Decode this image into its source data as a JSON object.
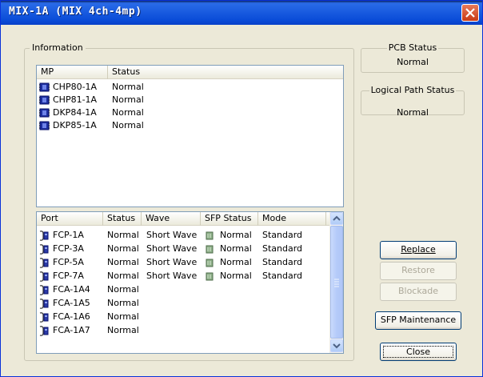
{
  "window": {
    "title": "MIX-1A (MIX 4ch-4mp)"
  },
  "information": {
    "legend": "Information"
  },
  "mp_list": {
    "columns": [
      "MP",
      "Status"
    ],
    "rows": [
      {
        "name": "CHP80-1A",
        "status": "Normal"
      },
      {
        "name": "CHP81-1A",
        "status": "Normal"
      },
      {
        "name": "DKP84-1A",
        "status": "Normal"
      },
      {
        "name": "DKP85-1A",
        "status": "Normal"
      }
    ]
  },
  "port_list": {
    "columns": [
      "Port",
      "Status",
      "Wave",
      "SFP Status",
      "Mode"
    ],
    "rows": [
      {
        "port": "FCP-1A",
        "status": "Normal",
        "wave": "Short Wave",
        "sfp": "Normal",
        "mode": "Standard"
      },
      {
        "port": "FCP-3A",
        "status": "Normal",
        "wave": "Short Wave",
        "sfp": "Normal",
        "mode": "Standard"
      },
      {
        "port": "FCP-5A",
        "status": "Normal",
        "wave": "Short Wave",
        "sfp": "Normal",
        "mode": "Standard"
      },
      {
        "port": "FCP-7A",
        "status": "Normal",
        "wave": "Short Wave",
        "sfp": "Normal",
        "mode": "Standard"
      },
      {
        "port": "FCA-1A4",
        "status": "Normal",
        "wave": "",
        "sfp": "",
        "mode": ""
      },
      {
        "port": "FCA-1A5",
        "status": "Normal",
        "wave": "",
        "sfp": "",
        "mode": ""
      },
      {
        "port": "FCA-1A6",
        "status": "Normal",
        "wave": "",
        "sfp": "",
        "mode": ""
      },
      {
        "port": "FCA-1A7",
        "status": "Normal",
        "wave": "",
        "sfp": "",
        "mode": ""
      }
    ]
  },
  "pcb_status": {
    "title": "PCB Status",
    "value": "Normal"
  },
  "logical_path_status": {
    "title": "Logical Path Status",
    "value": "Normal"
  },
  "buttons": {
    "replace": "Replace",
    "restore": "Restore",
    "blockade": "Blockade",
    "sfp_maintenance": "SFP Maintenance",
    "close": "Close"
  },
  "icons": {
    "mp_row": "processor-chip-icon",
    "port_row": "port-connector-icon",
    "sfp": "sfp-module-icon",
    "window_close": "close-icon"
  },
  "colors": {
    "titlebar": "#0A4CD8",
    "dialog_bg": "#ECE9D8",
    "list_border": "#7F9DB9"
  }
}
